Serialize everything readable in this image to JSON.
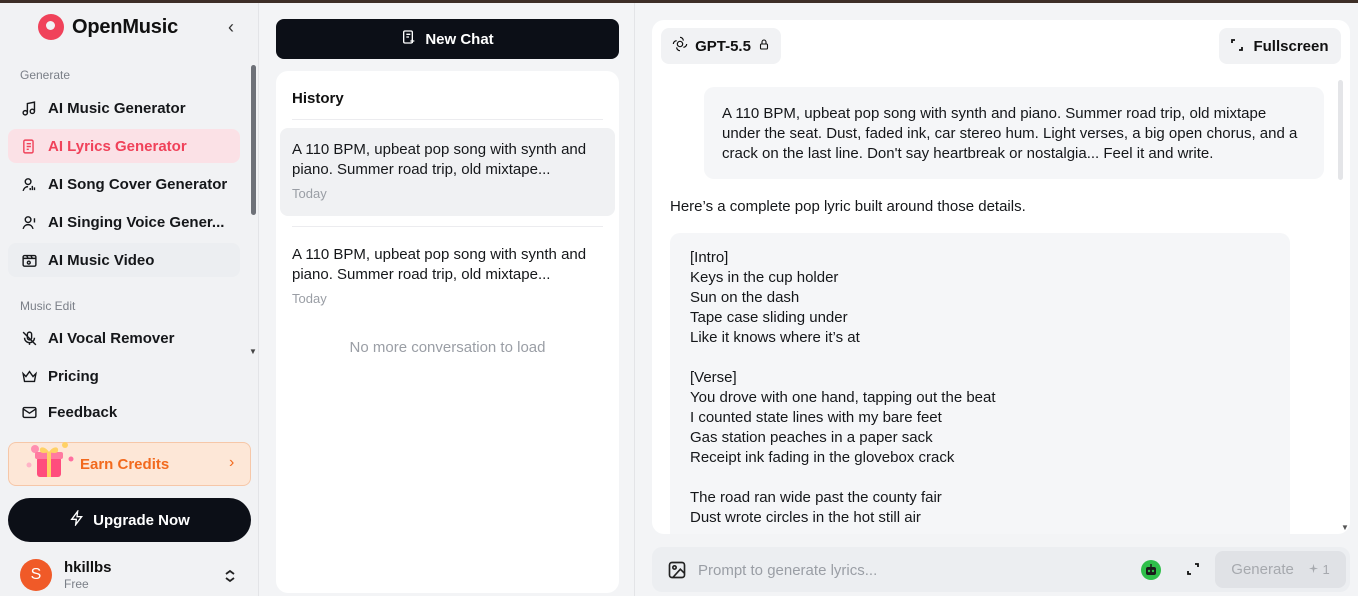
{
  "app": {
    "logo_text": "OpenMusic"
  },
  "sidebar": {
    "collapse_glyph": "‹",
    "sections": [
      {
        "label": "Generate",
        "items": [
          {
            "label": "AI Music Generator",
            "icon": "music-note-icon"
          },
          {
            "label": "AI Lyrics Generator",
            "icon": "lyrics-document-icon",
            "active": true
          },
          {
            "label": "AI Song Cover Generator",
            "icon": "microphone-person-icon"
          },
          {
            "label": "AI Singing Voice Gener...",
            "icon": "user-voice-icon"
          },
          {
            "label": "AI Music Video",
            "icon": "video-music-icon"
          }
        ]
      },
      {
        "label": "Music Edit",
        "items": [
          {
            "label": "AI Vocal Remover",
            "icon": "mic-off-icon"
          }
        ]
      }
    ],
    "extra_items": [
      {
        "label": "Pricing",
        "icon": "crown-icon"
      },
      {
        "label": "Feedback",
        "icon": "mail-icon"
      }
    ],
    "earn_credits": {
      "label": "Earn Credits",
      "chevron": "›"
    },
    "upgrade": {
      "label": "Upgrade Now"
    },
    "user": {
      "initial": "S",
      "name": "hkillbs",
      "plan": "Free"
    }
  },
  "history": {
    "new_chat_label": "New Chat",
    "title": "History",
    "items": [
      {
        "text": "A 110 BPM, upbeat pop song with synth and piano. Summer road trip, old mixtape...",
        "date": "Today",
        "selected": true
      },
      {
        "text": "A 110 BPM, upbeat pop song with synth and piano. Summer road trip, old mixtape...",
        "date": "Today",
        "selected": false
      }
    ],
    "empty_text": "No more conversation to load"
  },
  "chat": {
    "model_label": "GPT-5.5",
    "fullscreen_label": "Fullscreen",
    "user_message": "A 110 BPM, upbeat pop song with synth and piano. Summer road trip, old mixtape under the seat. Dust, faded ink, car stereo hum. Light verses, a big open chorus, and a crack on the last line. Don't say heartbreak or nostalgia... Feel it and write.",
    "assistant_intro": "Here’s a complete pop lyric built around those details.",
    "lyrics": [
      "[Intro]",
      "Keys in the cup holder",
      "Sun on the dash",
      "Tape case sliding under",
      "Like it knows where it’s at",
      "",
      "[Verse]",
      "You drove with one hand, tapping out the beat",
      "I counted state lines with my bare feet",
      "Gas station peaches in a paper sack",
      "Receipt ink fading in the glovebox crack",
      "",
      "The road ran wide past the county fair",
      "Dust wrote circles in the hot still air"
    ]
  },
  "prompt": {
    "placeholder": "Prompt to generate lyrics...",
    "generate_label": "Generate",
    "generate_cost": "1"
  },
  "colors": {
    "brand": "#f0425a",
    "active_bg": "#fbe1e6",
    "dark_button": "#0c0f17",
    "earn_orange": "#f26a1e",
    "avatar": "#f05a28",
    "bot_green": "#2fbf4a"
  }
}
